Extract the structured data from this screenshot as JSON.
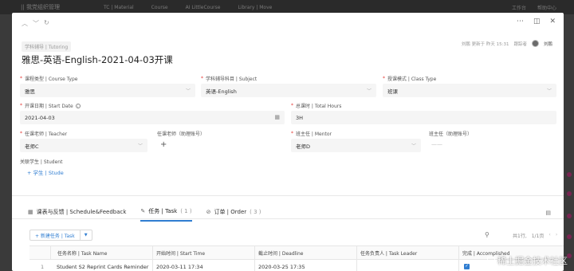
{
  "background": {
    "logo": "|| 我党组织管理",
    "nav": [
      "TC | Material",
      "Course",
      "AI LittleCourse",
      "Library | Move"
    ],
    "right_items": [
      "工作台",
      "帮助中心"
    ]
  },
  "modal": {
    "tag": "学科辅导 | Tutoring",
    "meta_updated": "刘鹏 更新于 昨天 15:31",
    "meta_owner_label": "跟踪者",
    "meta_user": "刘鹏",
    "title": "雅思-英语-English-2021-04-03开课"
  },
  "form": {
    "course_type": {
      "label": "课程类型 | Course Type",
      "value": "雅思"
    },
    "subject": {
      "label": "学科辅导科目 | Subject",
      "value": "英语-English"
    },
    "class_type": {
      "label": "授课模式 | Class Type",
      "value": "班课"
    },
    "start_date": {
      "label": "开课日期 | Start Date",
      "value": "2021-04-03"
    },
    "total_hours": {
      "label": "总课时 | Total Hours",
      "value": "3H"
    },
    "teacher": {
      "label": "任课老师 | Teacher",
      "value": "老师C"
    },
    "teacher_account": {
      "label": "任课老师（助理账号）",
      "value": "+"
    },
    "mentor": {
      "label": "班主任 | Mentor",
      "value": "老师D"
    },
    "mentor_account": {
      "label": "班主任（助理账号）",
      "value": "——"
    },
    "student": {
      "label": "关联学生 | Student",
      "add": "+ 学生 | Stude"
    }
  },
  "tabs": [
    {
      "label": "课表与反馈 | Schedule&Feedback",
      "count": ""
    },
    {
      "label": "任务 | Task",
      "count": "( 1 )"
    },
    {
      "label": "订单 | Order",
      "count": "( 3 )"
    }
  ],
  "toolbar": {
    "new_task": "+ 新建任务 | Task",
    "pager_total": "共1行,",
    "pager_page": "1/1页"
  },
  "table": {
    "headers": [
      "任务名称 | Task Name",
      "开始时间 | Start Time",
      "截止时间 | Deadline",
      "任务负责人 | Task Leader",
      "完成 | Accomplished"
    ],
    "rows": [
      {
        "index": "1",
        "name": "Student S2 Reprint Cards Reminder",
        "start": "2020-03-11 17:34",
        "deadline": "2020-03-25 17:35",
        "leader": "",
        "done": "✓"
      }
    ]
  },
  "watermark": "稀土掘金技术社区"
}
